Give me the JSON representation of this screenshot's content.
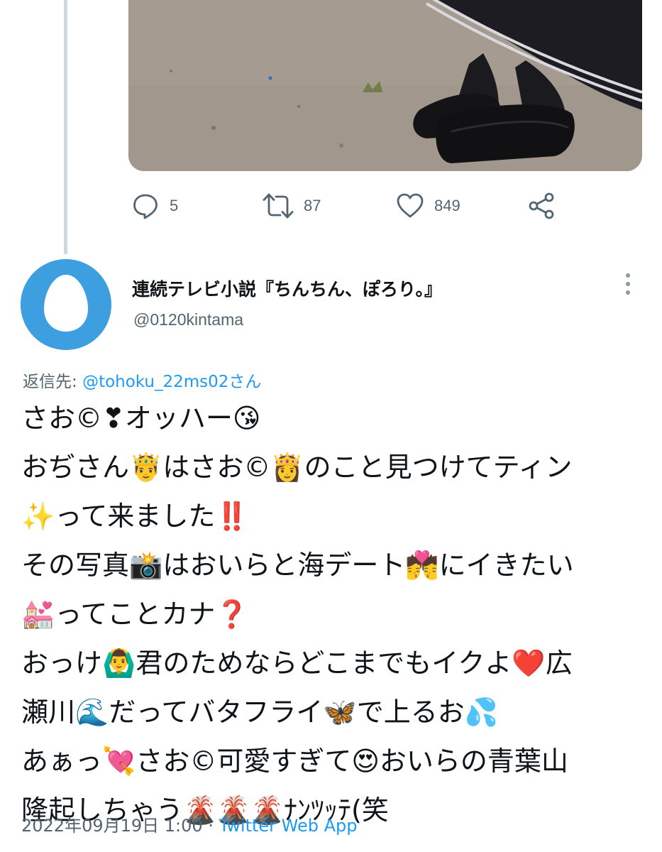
{
  "tweet_above": {
    "stats": {
      "replies": "5",
      "retweets": "87",
      "likes": "849"
    }
  },
  "reply": {
    "display_name": "連続テレビ小説『ちんちん、ぽろり。』",
    "handle": "@0120kintama",
    "reply_label": "返信先: ",
    "reply_mention": "@tohoku_22ms02さん",
    "body_lines": [
      "さお©❣オッハー😘",
      "おぢさん🤴はさお©👸のこと見つけてティン",
      "✨って来ました‼️",
      "その写真📸はおいらと海デート💏にイきたい",
      "💒ってことカナ❓",
      "おっけ🙆‍♂️君のためならどこまでもイクよ❤️広",
      "瀬川🌊だってバタフライ🦋で上るお💦",
      "あぁっ💘さお©可愛すぎて😍おいらの青葉山",
      "隆起しちゃう🌋🌋🌋ﾅﾝﾂｯﾃ(笑"
    ],
    "timestamp": "2022年09月19日 1:00 · ",
    "source": "Twitter Web App"
  },
  "colors": {
    "text_primary": "#0f1419",
    "text_secondary": "#536471",
    "link": "#1d9bf0",
    "avatar_bg": "#3d9ee0",
    "thread_line": "#cfd9de"
  },
  "icons": [
    "reply-icon",
    "retweet-icon",
    "like-icon",
    "share-icon",
    "more-icon",
    "default-egg-avatar"
  ]
}
